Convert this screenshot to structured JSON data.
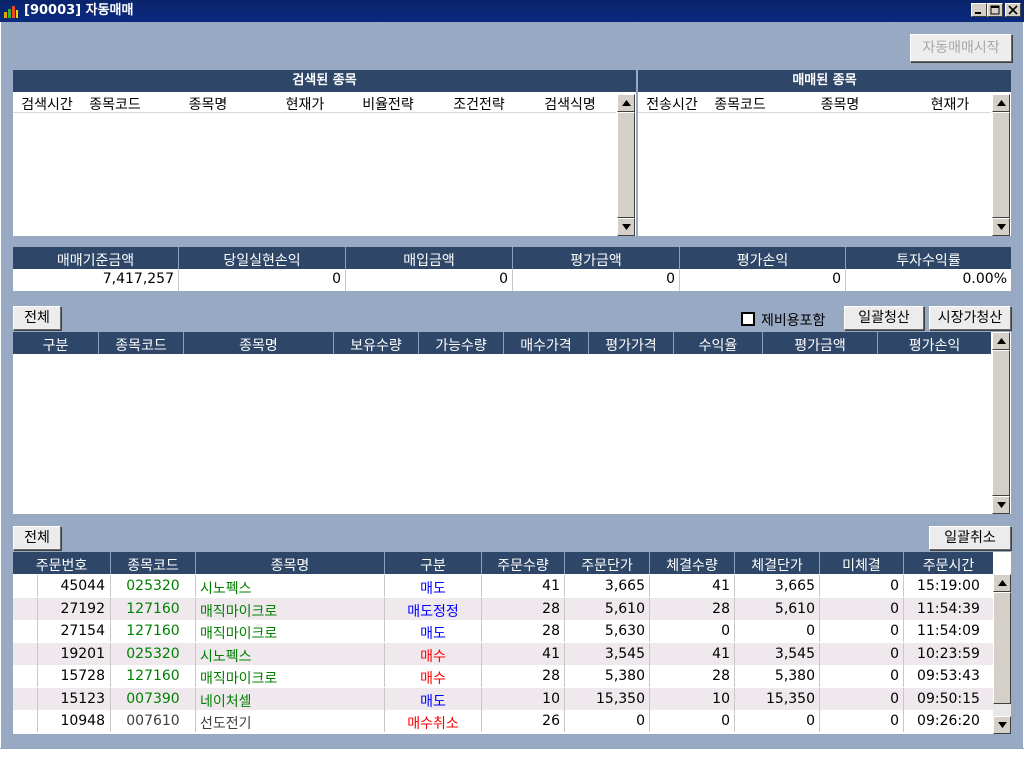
{
  "window": {
    "title": "[90003] 자동매매"
  },
  "toolbar": {
    "start_auto_trade": "자동매매시작"
  },
  "searched": {
    "caption": "검색된 종목",
    "columns": [
      "검색시간",
      "종목코드",
      "종목명",
      "현재가",
      "비율전략",
      "조건전략",
      "검색식명"
    ]
  },
  "traded": {
    "caption": "매매된 종목",
    "columns": [
      "전송시간",
      "종목코드",
      "종목명",
      "현재가"
    ]
  },
  "summary": {
    "headers": [
      "매매기준금액",
      "당일실현손익",
      "매입금액",
      "평가금액",
      "평가손익",
      "투자수익률"
    ],
    "values": [
      "7,417,257",
      "0",
      "0",
      "0",
      "0",
      "0.00%"
    ]
  },
  "holdings": {
    "all_button": "전체",
    "include_fees_label": "제비용포함",
    "include_fees_checked": false,
    "bulk_liquidate": "일괄청산",
    "market_liquidate": "시장가청산",
    "columns": [
      "구분",
      "종목코드",
      "종목명",
      "보유수량",
      "가능수량",
      "매수가격",
      "평가가격",
      "수익율",
      "평가금액",
      "평가손익"
    ]
  },
  "orders": {
    "all_button": "전체",
    "bulk_cancel": "일괄취소",
    "columns": [
      "주문번호",
      "종목코드",
      "종목명",
      "구분",
      "주문수량",
      "주문단가",
      "체결수량",
      "체결단가",
      "미체결",
      "주문시간"
    ],
    "rows": [
      {
        "no": "45044",
        "code": "025320",
        "name": "시노펙스",
        "type": "매도",
        "qty": "41",
        "price": "3,665",
        "filled": "41",
        "fill_price": "3,665",
        "unfilled": "0",
        "time": "15:19:00",
        "type_color": "#0000ff",
        "code_color": "#008000"
      },
      {
        "no": "27192",
        "code": "127160",
        "name": "매직마이크로",
        "type": "매도정정",
        "qty": "28",
        "price": "5,610",
        "filled": "28",
        "fill_price": "5,610",
        "unfilled": "0",
        "time": "11:54:39",
        "type_color": "#0000ff",
        "code_color": "#008000"
      },
      {
        "no": "27154",
        "code": "127160",
        "name": "매직마이크로",
        "type": "매도",
        "qty": "28",
        "price": "5,630",
        "filled": "0",
        "fill_price": "0",
        "unfilled": "0",
        "time": "11:54:09",
        "type_color": "#0000ff",
        "code_color": "#008000"
      },
      {
        "no": "19201",
        "code": "025320",
        "name": "시노펙스",
        "type": "매수",
        "qty": "41",
        "price": "3,545",
        "filled": "41",
        "fill_price": "3,545",
        "unfilled": "0",
        "time": "10:23:59",
        "type_color": "#ff0000",
        "code_color": "#008000"
      },
      {
        "no": "15728",
        "code": "127160",
        "name": "매직마이크로",
        "type": "매수",
        "qty": "28",
        "price": "5,380",
        "filled": "28",
        "fill_price": "5,380",
        "unfilled": "0",
        "time": "09:53:43",
        "type_color": "#ff0000",
        "code_color": "#008000"
      },
      {
        "no": "15123",
        "code": "007390",
        "name": "네이처셀",
        "type": "매도",
        "qty": "10",
        "price": "15,350",
        "filled": "10",
        "fill_price": "15,350",
        "unfilled": "0",
        "time": "09:50:15",
        "type_color": "#0000ff",
        "code_color": "#008000"
      },
      {
        "no": "10948",
        "code": "007610",
        "name": "선도전기",
        "type": "매수취소",
        "qty": "26",
        "price": "0",
        "filled": "0",
        "fill_price": "0",
        "unfilled": "0",
        "time": "09:26:20",
        "type_color": "#ff0000",
        "code_color": "#404040"
      }
    ]
  },
  "colors": {
    "header_bg": "#2e4667",
    "client_bg": "#98a9c3",
    "title_bg": "#0a246a",
    "alt_row": "#efe9ee"
  }
}
